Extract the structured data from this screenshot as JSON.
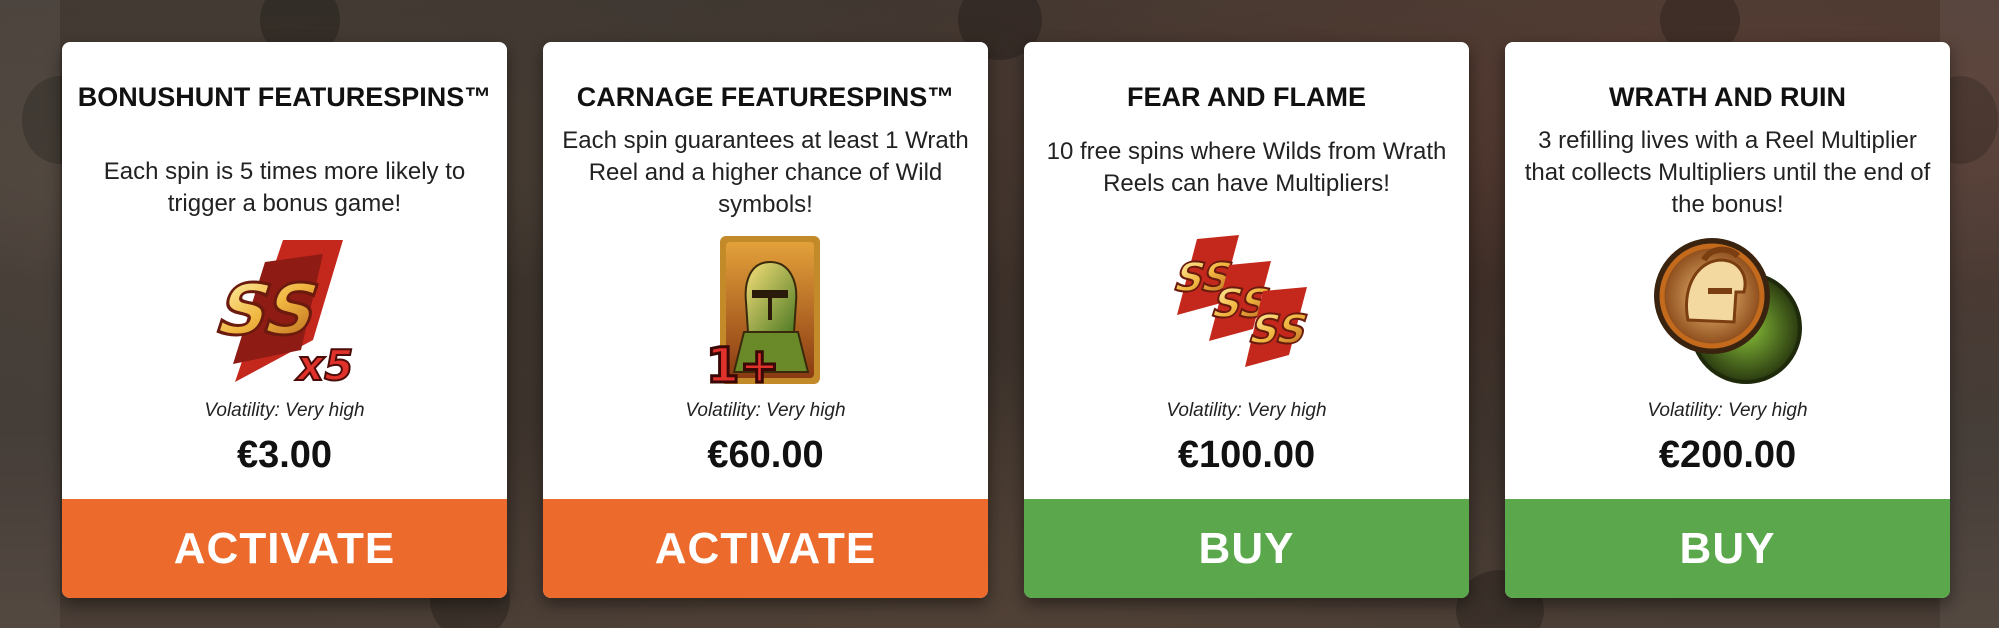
{
  "colors": {
    "activate": "#ec6a2c",
    "buy": "#5aa84b",
    "card_bg": "#ffffff",
    "title_text": "#111111"
  },
  "cards": [
    {
      "title": "BONUSHUNT FEATURESPINS™",
      "description": "Each spin is 5 times more likely to trigger a bonus game!",
      "art_icon": "ss-x5-icon",
      "art_text": "x5",
      "volatility": "Volatility: Very high",
      "price": "€3.00",
      "button_label": "ACTIVATE",
      "button_type": "activate"
    },
    {
      "title": "CARNAGE FEATURESPINS™",
      "description": "Each spin guarantees at least 1 Wrath Reel and a higher chance of Wild symbols!",
      "art_icon": "knight-card-icon",
      "art_text": "1+",
      "volatility": "Volatility: Very high",
      "price": "€60.00",
      "button_label": "ACTIVATE",
      "button_type": "activate"
    },
    {
      "title": "FEAR AND FLAME",
      "description": "10 free spins where Wilds from Wrath Reels can have Multipliers!",
      "art_icon": "triple-ss-icon",
      "volatility": "Volatility: Very high",
      "price": "€100.00",
      "button_label": "BUY",
      "button_type": "buy"
    },
    {
      "title": "WRATH AND RUIN",
      "description": "3 refilling lives with a Reel Multiplier that collects Multipliers until the end of the bonus!",
      "art_icon": "helmet-coins-icon",
      "volatility": "Volatility: Very high",
      "price": "€200.00",
      "button_label": "BUY",
      "button_type": "buy"
    }
  ]
}
